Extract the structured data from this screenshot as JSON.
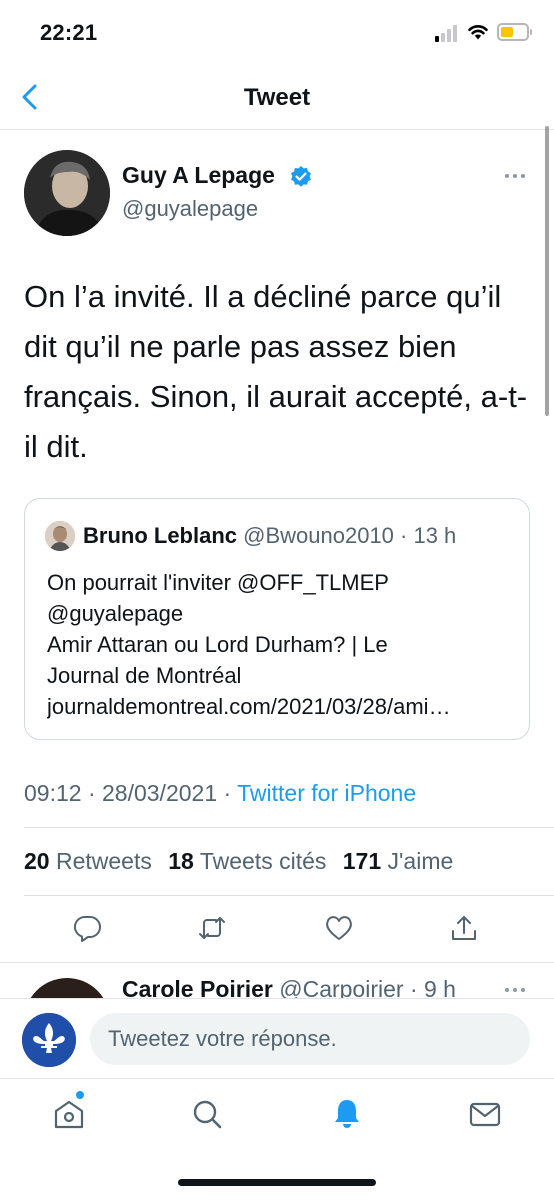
{
  "status_bar": {
    "time": "22:21"
  },
  "nav": {
    "title": "Tweet"
  },
  "tweet": {
    "author_name": "Guy A Lepage",
    "author_handle": "@guyalepage",
    "text": "On l’a invité. Il a décliné parce qu’il dit qu’il ne parle pas assez bien français. Sinon, il aurait accepté, a-t-il dit.",
    "quoted": {
      "author_name": "Bruno Leblanc",
      "meta": "@Bwouno2010 · 13 h",
      "lines": [
        "On pourrait l'inviter @OFF_TLMEP",
        "@guyalepage",
        "Amir Attaran ou Lord Durham? | Le",
        "Journal de Montréal",
        "journaldemontreal.com/2021/03/28/ami…"
      ]
    },
    "timestamp": "09:12 · 28/03/2021 · ",
    "source": "Twitter for iPhone",
    "stats": {
      "retweets_count": "20",
      "retweets_label": "Retweets",
      "quotes_count": "18",
      "quotes_label": "Tweets cités",
      "likes_count": "171",
      "likes_label": "J'aime"
    }
  },
  "reply_preview": {
    "author_name": "Carole Poirier",
    "meta": "@Carpoirier · 9 h"
  },
  "compose": {
    "placeholder": "Tweetez votre réponse."
  },
  "colors": {
    "accent": "#1d9bf0",
    "text": "#0f1419",
    "muted": "#536471",
    "battery": "#f7c600"
  },
  "icons": {
    "actions": [
      "reply-icon",
      "retweet-icon",
      "like-icon",
      "share-icon"
    ],
    "tabs": [
      "home-icon",
      "search-icon",
      "notifications-icon",
      "messages-icon"
    ]
  }
}
